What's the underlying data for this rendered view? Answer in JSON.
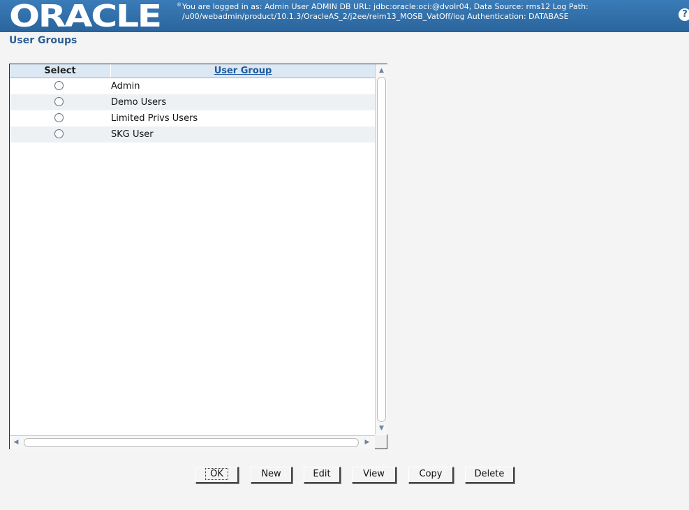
{
  "header": {
    "logo": "ORACLE",
    "trademark": "®",
    "info_line1": "You are logged in as: Admin User ADMIN    DB URL: jdbc:oracle:oci:@dvolr04,  Data Source: rms12  Log Path:",
    "info_line2": "/u00/webadmin/product/10.1.3/OracleAS_2/j2ee/reim13_MOSB_VatOff/log  Authentication: DATABASE",
    "help_icon": "?"
  },
  "page": {
    "title": "User Groups"
  },
  "table": {
    "columns": [
      "Select",
      "User Group"
    ],
    "rows": [
      {
        "user_group": "Admin"
      },
      {
        "user_group": "Demo Users"
      },
      {
        "user_group": "Limited Privs Users"
      },
      {
        "user_group": "SKG User"
      }
    ]
  },
  "scroll": {
    "up": "▲",
    "down": "▼",
    "left": "◀",
    "right": "▶"
  },
  "buttons": {
    "ok": "OK",
    "new": "New",
    "edit": "Edit",
    "view": "View",
    "copy": "Copy",
    "delete": "Delete"
  }
}
